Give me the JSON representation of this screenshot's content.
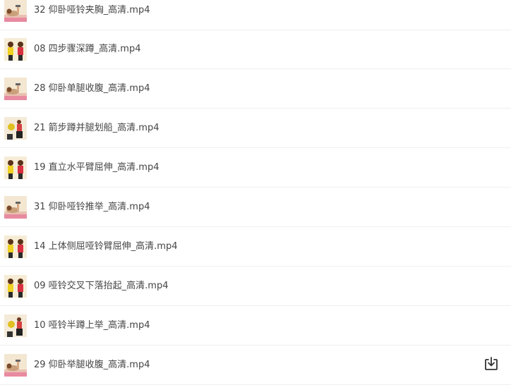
{
  "files": [
    {
      "name": "32 仰卧哑铃夹胸_高清.mp4",
      "thumb": "lying",
      "icon": "video-thumbnail-icon"
    },
    {
      "name": "08 四步骤深蹲_高清.mp4",
      "thumb": "two",
      "icon": "video-thumbnail-icon"
    },
    {
      "name": "28 仰卧单腿收腹_高清.mp4",
      "thumb": "lying",
      "icon": "video-thumbnail-icon"
    },
    {
      "name": "21 箭步蹲并腿划船_高清.mp4",
      "thumb": "squat",
      "icon": "video-thumbnail-icon"
    },
    {
      "name": "19 直立水平臂屈伸_高清.mp4",
      "thumb": "two",
      "icon": "video-thumbnail-icon"
    },
    {
      "name": "31 仰卧哑铃推举_高清.mp4",
      "thumb": "lying",
      "icon": "video-thumbnail-icon"
    },
    {
      "name": "14 上体侧屈哑铃臂屈伸_高清.mp4",
      "thumb": "two",
      "icon": "video-thumbnail-icon"
    },
    {
      "name": "09 哑铃交叉下落抬起_高清.mp4",
      "thumb": "two",
      "icon": "video-thumbnail-icon"
    },
    {
      "name": "10 哑铃半蹲上举_高清.mp4",
      "thumb": "squat",
      "icon": "video-thumbnail-icon"
    },
    {
      "name": "29 仰卧举腿收腹_高清.mp4",
      "thumb": "lying",
      "icon": "video-thumbnail-icon"
    }
  ],
  "download_icon": "download-icon",
  "colors": {
    "text": "#454545",
    "divider": "#efefef",
    "icon": "#333333"
  }
}
